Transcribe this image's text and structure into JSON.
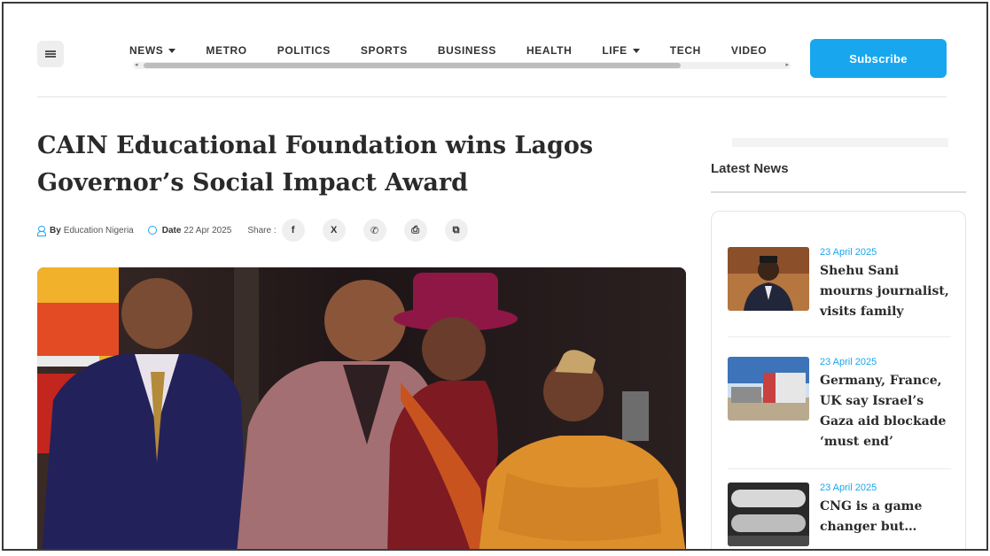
{
  "header": {
    "nav": [
      {
        "label": "NEWS",
        "dropdown": true
      },
      {
        "label": "METRO",
        "dropdown": false
      },
      {
        "label": "POLITICS",
        "dropdown": false
      },
      {
        "label": "SPORTS",
        "dropdown": false
      },
      {
        "label": "BUSINESS",
        "dropdown": false
      },
      {
        "label": "HEALTH",
        "dropdown": false
      },
      {
        "label": "LIFE",
        "dropdown": true
      },
      {
        "label": "TECH",
        "dropdown": false
      },
      {
        "label": "VIDEO",
        "dropdown": false
      }
    ],
    "subscribe_label": "Subscribe",
    "accent_color": "#18a7ee"
  },
  "article": {
    "title": "CAIN Educational Foundation wins Lagos Governor’s Social Impact Award",
    "byline_label": "By",
    "author": "Education Nigeria",
    "date_label": "Date",
    "date": "22 Apr 2025",
    "share_label": "Share :",
    "share_icons": [
      "facebook-icon",
      "x-icon",
      "whatsapp-icon",
      "print-icon",
      "copy-icon"
    ],
    "share_glyphs": [
      "f",
      "X",
      "✆",
      "⎙",
      "⧉"
    ]
  },
  "sidebar": {
    "title": "Latest News",
    "items": [
      {
        "date": "23 April 2025",
        "title": "Shehu Sani mourns journalist, visits family"
      },
      {
        "date": "23 April 2025",
        "title": "Germany, France, UK say Israel’s Gaza aid blockade ‘must end’"
      },
      {
        "date": "23 April 2025",
        "title": "CNG is a game changer but…"
      }
    ]
  }
}
